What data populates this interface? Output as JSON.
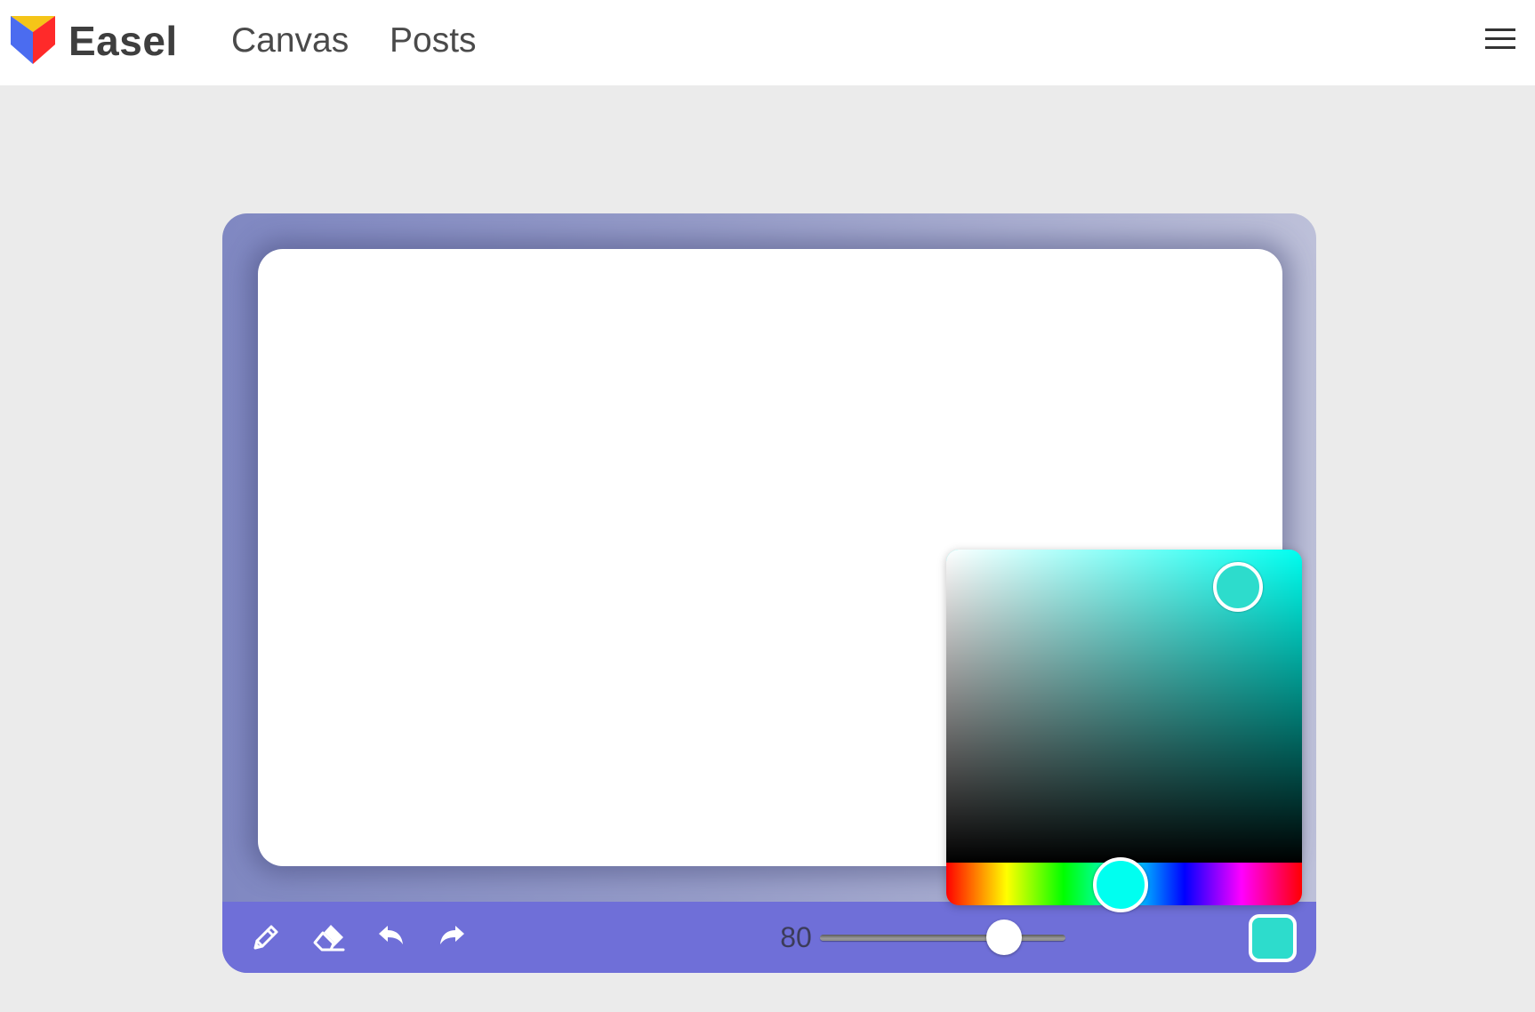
{
  "header": {
    "brand": "Easel",
    "nav": [
      {
        "label": "Canvas"
      },
      {
        "label": "Posts"
      }
    ],
    "menu_icon": "hamburger-menu-icon",
    "logo_icon": "easel-logo-icon",
    "logo_colors": [
      "#f5c518",
      "#ff2a2a",
      "#4b6cf0"
    ]
  },
  "canvas": {
    "background_color": "#ffffff",
    "frame_color": "#8d93c6"
  },
  "toolbar": {
    "color": "#6f6fd8",
    "tools": [
      {
        "name": "pencil",
        "icon": "pencil-icon"
      },
      {
        "name": "eraser",
        "icon": "eraser-icon"
      },
      {
        "name": "undo",
        "icon": "undo-icon"
      },
      {
        "name": "redo",
        "icon": "redo-icon"
      }
    ],
    "brush_size": {
      "value": "80",
      "min": 0,
      "max": 100,
      "level": 0.75
    },
    "selected_color": "#2ddccc"
  },
  "color_picker": {
    "hue_color": "#00fff0",
    "saturation": 0.82,
    "brightness": 0.88,
    "hue_level": 0.49
  }
}
